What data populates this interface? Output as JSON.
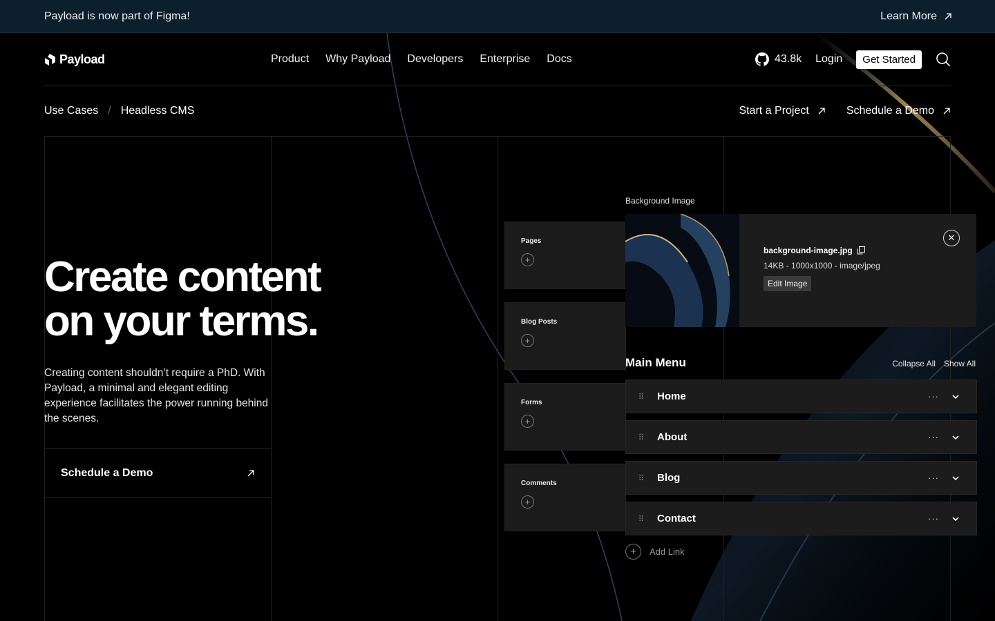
{
  "announcement": {
    "text": "Payload is now part of Figma!",
    "link": "Learn More"
  },
  "nav": {
    "logo_text": "Payload",
    "links": [
      "Product",
      "Why Payload",
      "Developers",
      "Enterprise",
      "Docs"
    ],
    "github_stars": "43.8k",
    "login": "Login",
    "cta": "Get Started"
  },
  "breadcrumb": {
    "items": [
      "Use Cases",
      "Headless CMS"
    ],
    "separator": "/",
    "actions": [
      "Start a Project",
      "Schedule a Demo"
    ]
  },
  "hero": {
    "title_line1": "Create content",
    "title_line2": "on your terms.",
    "description": "Creating content shouldn’t require a PhD. With Payload, a minimal and elegant editing experience facilitates the power running behind the scenes.",
    "cta": "Schedule a Demo"
  },
  "collections": [
    "Pages",
    "Blog Posts",
    "Forms",
    "Comments"
  ],
  "upload": {
    "label": "Background Image",
    "filename": "background-image.jpg",
    "meta": "14KB - 1000x1000 - image/jpeg",
    "edit_label": "Edit Image"
  },
  "menu": {
    "title": "Main Menu",
    "collapse_all": "Collapse All",
    "show_all": "Show All",
    "items": [
      "Home",
      "About",
      "Blog",
      "Contact"
    ],
    "add_link": "Add Link"
  },
  "colors": {
    "announcement_bg": "#0c1f2c",
    "accent_gold": "#c9a46a",
    "surface": "#1c1c1c"
  }
}
